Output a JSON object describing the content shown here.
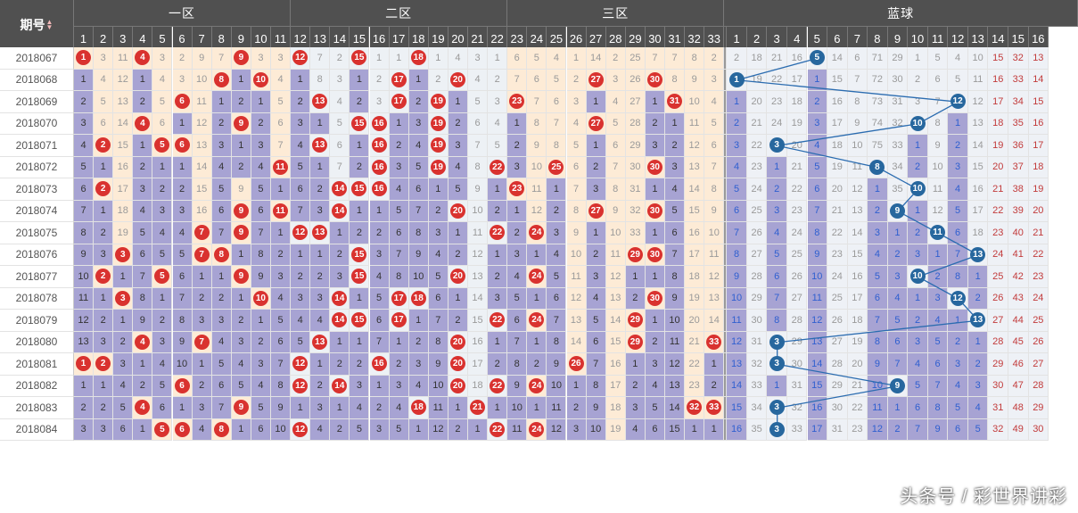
{
  "header": {
    "period": "期号",
    "zones": [
      "一区",
      "二区",
      "三区",
      "蓝球"
    ]
  },
  "red_cols": [
    "1",
    "2",
    "3",
    "4",
    "5",
    "6",
    "7",
    "8",
    "9",
    "10",
    "11",
    "12",
    "13",
    "14",
    "15",
    "16",
    "17",
    "18",
    "19",
    "20",
    "21",
    "22",
    "23",
    "24",
    "25",
    "26",
    "27",
    "28",
    "29",
    "30",
    "31",
    "32",
    "33"
  ],
  "blue_cols": [
    "1",
    "2",
    "3",
    "4",
    "5",
    "6",
    "7",
    "8",
    "9",
    "10",
    "11",
    "12",
    "13",
    "14",
    "15",
    "16"
  ],
  "rows": [
    {
      "p": "2018067",
      "hits": [
        1,
        4,
        9,
        12,
        15,
        18
      ],
      "blue": 5,
      "red_vals": [
        "1",
        "3",
        "11",
        "4",
        "3",
        "2",
        "9",
        "7",
        "9",
        "3",
        "3",
        "12",
        "7",
        "2",
        "15",
        "1",
        "1",
        "18",
        "1",
        "4",
        "3",
        "1",
        "6",
        "5",
        "4",
        "1",
        "14",
        "2",
        "25",
        "7",
        "7",
        "8",
        "2"
      ],
      "blue_vals": [
        "2",
        "18",
        "21",
        "16",
        "5",
        "14",
        "6",
        "71",
        "29",
        "1",
        "5",
        "4",
        "10",
        "15",
        "32",
        "13"
      ]
    },
    {
      "p": "2018068",
      "hits": [
        8,
        10,
        17,
        20,
        27,
        30
      ],
      "blue": 1,
      "red_vals": [
        "1",
        "4",
        "12",
        "1",
        "4",
        "3",
        "10",
        "8",
        "1",
        "10",
        "4",
        "1",
        "8",
        "3",
        "1",
        "2",
        "17",
        "1",
        "2",
        "20",
        "4",
        "2",
        "7",
        "6",
        "5",
        "2",
        "27",
        "3",
        "26",
        "30",
        "8",
        "9",
        "3"
      ],
      "blue_vals": [
        "1",
        "19",
        "22",
        "17",
        "1",
        "15",
        "7",
        "72",
        "30",
        "2",
        "6",
        "5",
        "11",
        "16",
        "33",
        "14"
      ]
    },
    {
      "p": "2018069",
      "hits": [
        6,
        13,
        17,
        19,
        23,
        31
      ],
      "blue": 12,
      "red_vals": [
        "2",
        "5",
        "13",
        "2",
        "5",
        "6",
        "11",
        "1",
        "2",
        "1",
        "5",
        "2",
        "13",
        "4",
        "2",
        "3",
        "17",
        "2",
        "19",
        "1",
        "5",
        "3",
        "23",
        "7",
        "6",
        "3",
        "1",
        "4",
        "27",
        "1",
        "31",
        "10",
        "4"
      ],
      "blue_vals": [
        "1",
        "20",
        "23",
        "18",
        "2",
        "16",
        "8",
        "73",
        "31",
        "3",
        "7",
        "12",
        "12",
        "17",
        "34",
        "15"
      ]
    },
    {
      "p": "2018070",
      "hits": [
        4,
        9,
        15,
        16,
        19,
        27
      ],
      "blue": 10,
      "red_vals": [
        "3",
        "6",
        "14",
        "4",
        "6",
        "1",
        "12",
        "2",
        "9",
        "2",
        "6",
        "3",
        "1",
        "5",
        "15",
        "16",
        "1",
        "3",
        "19",
        "2",
        "6",
        "4",
        "1",
        "8",
        "7",
        "4",
        "27",
        "5",
        "28",
        "2",
        "1",
        "11",
        "5"
      ],
      "blue_vals": [
        "2",
        "21",
        "24",
        "19",
        "3",
        "17",
        "9",
        "74",
        "32",
        "10",
        "8",
        "1",
        "13",
        "18",
        "35",
        "16"
      ]
    },
    {
      "p": "2018071",
      "hits": [
        2,
        5,
        6,
        13,
        16,
        19
      ],
      "blue": 3,
      "red_vals": [
        "4",
        "2",
        "15",
        "1",
        "5",
        "6",
        "13",
        "3",
        "1",
        "3",
        "7",
        "4",
        "13",
        "6",
        "1",
        "16",
        "2",
        "4",
        "19",
        "3",
        "7",
        "5",
        "2",
        "9",
        "8",
        "5",
        "1",
        "6",
        "29",
        "3",
        "2",
        "12",
        "6"
      ],
      "blue_vals": [
        "3",
        "22",
        "3",
        "20",
        "4",
        "18",
        "10",
        "75",
        "33",
        "1",
        "9",
        "2",
        "14",
        "19",
        "36",
        "17"
      ]
    },
    {
      "p": "2018072",
      "hits": [
        11,
        16,
        19,
        22,
        25,
        30
      ],
      "blue": 8,
      "red_vals": [
        "5",
        "1",
        "16",
        "2",
        "1",
        "1",
        "14",
        "4",
        "2",
        "4",
        "11",
        "5",
        "1",
        "7",
        "2",
        "16",
        "3",
        "5",
        "19",
        "4",
        "8",
        "22",
        "3",
        "10",
        "25",
        "6",
        "2",
        "7",
        "30",
        "30",
        "3",
        "13",
        "7"
      ],
      "blue_vals": [
        "4",
        "23",
        "1",
        "21",
        "5",
        "19",
        "11",
        "8",
        "34",
        "2",
        "10",
        "3",
        "15",
        "20",
        "37",
        "18"
      ]
    },
    {
      "p": "2018073",
      "hits": [
        2,
        14,
        15,
        16,
        23
      ],
      "blue": 10,
      "red_vals": [
        "6",
        "2",
        "17",
        "3",
        "2",
        "2",
        "15",
        "5",
        "9",
        "5",
        "1",
        "6",
        "2",
        "14",
        "15",
        "16",
        "4",
        "6",
        "1",
        "5",
        "9",
        "1",
        "23",
        "11",
        "1",
        "7",
        "3",
        "8",
        "31",
        "1",
        "4",
        "14",
        "8"
      ],
      "blue_vals": [
        "5",
        "24",
        "2",
        "22",
        "6",
        "20",
        "12",
        "1",
        "35",
        "10",
        "11",
        "4",
        "16",
        "21",
        "38",
        "19"
      ]
    },
    {
      "p": "2018074",
      "hits": [
        9,
        11,
        14,
        20,
        27,
        30
      ],
      "blue": 9,
      "red_vals": [
        "7",
        "1",
        "18",
        "4",
        "3",
        "3",
        "16",
        "6",
        "9",
        "6",
        "11",
        "7",
        "3",
        "14",
        "1",
        "1",
        "5",
        "7",
        "2",
        "20",
        "10",
        "2",
        "1",
        "12",
        "2",
        "8",
        "27",
        "9",
        "32",
        "30",
        "5",
        "15",
        "9"
      ],
      "blue_vals": [
        "6",
        "25",
        "3",
        "23",
        "7",
        "21",
        "13",
        "2",
        "9",
        "1",
        "12",
        "5",
        "17",
        "22",
        "39",
        "20"
      ]
    },
    {
      "p": "2018075",
      "hits": [
        7,
        9,
        12,
        13,
        22,
        24
      ],
      "blue": 11,
      "red_vals": [
        "8",
        "2",
        "19",
        "5",
        "4",
        "4",
        "7",
        "7",
        "9",
        "7",
        "1",
        "12",
        "13",
        "1",
        "2",
        "2",
        "6",
        "8",
        "3",
        "1",
        "11",
        "22",
        "2",
        "24",
        "3",
        "9",
        "1",
        "10",
        "33",
        "1",
        "6",
        "16",
        "10"
      ],
      "blue_vals": [
        "7",
        "26",
        "4",
        "24",
        "8",
        "22",
        "14",
        "3",
        "1",
        "2",
        "11",
        "6",
        "18",
        "23",
        "40",
        "21"
      ]
    },
    {
      "p": "2018076",
      "hits": [
        3,
        7,
        8,
        15,
        29,
        30
      ],
      "blue": 13,
      "red_vals": [
        "9",
        "3",
        "3",
        "6",
        "5",
        "5",
        "7",
        "8",
        "1",
        "8",
        "2",
        "1",
        "1",
        "2",
        "15",
        "3",
        "7",
        "9",
        "4",
        "2",
        "12",
        "1",
        "3",
        "1",
        "4",
        "10",
        "2",
        "11",
        "29",
        "30",
        "7",
        "17",
        "11"
      ],
      "blue_vals": [
        "8",
        "27",
        "5",
        "25",
        "9",
        "23",
        "15",
        "4",
        "2",
        "3",
        "1",
        "7",
        "13",
        "24",
        "41",
        "22"
      ]
    },
    {
      "p": "2018077",
      "hits": [
        2,
        5,
        9,
        15,
        20,
        24
      ],
      "blue": 10,
      "red_vals": [
        "10",
        "2",
        "1",
        "7",
        "5",
        "6",
        "1",
        "1",
        "9",
        "9",
        "3",
        "2",
        "2",
        "3",
        "15",
        "4",
        "8",
        "10",
        "5",
        "20",
        "13",
        "2",
        "4",
        "24",
        "5",
        "11",
        "3",
        "12",
        "1",
        "1",
        "8",
        "18",
        "12"
      ],
      "blue_vals": [
        "9",
        "28",
        "6",
        "26",
        "10",
        "24",
        "16",
        "5",
        "3",
        "10",
        "2",
        "8",
        "1",
        "25",
        "42",
        "23"
      ]
    },
    {
      "p": "2018078",
      "hits": [
        3,
        10,
        14,
        17,
        18,
        30
      ],
      "blue": 12,
      "red_vals": [
        "11",
        "1",
        "3",
        "8",
        "1",
        "7",
        "2",
        "2",
        "1",
        "10",
        "4",
        "3",
        "3",
        "14",
        "1",
        "5",
        "17",
        "18",
        "6",
        "1",
        "14",
        "3",
        "5",
        "1",
        "6",
        "12",
        "4",
        "13",
        "2",
        "30",
        "9",
        "19",
        "13"
      ],
      "blue_vals": [
        "10",
        "29",
        "7",
        "27",
        "11",
        "25",
        "17",
        "6",
        "4",
        "1",
        "3",
        "12",
        "2",
        "26",
        "43",
        "24"
      ]
    },
    {
      "p": "2018079",
      "hits": [
        14,
        15,
        17,
        22,
        24,
        29
      ],
      "blue": 13,
      "red_vals": [
        "12",
        "2",
        "1",
        "9",
        "2",
        "8",
        "3",
        "3",
        "2",
        "1",
        "5",
        "4",
        "4",
        "14",
        "15",
        "6",
        "17",
        "1",
        "7",
        "2",
        "15",
        "22",
        "6",
        "24",
        "7",
        "13",
        "5",
        "14",
        "29",
        "1",
        "10",
        "20",
        "14"
      ],
      "blue_vals": [
        "11",
        "30",
        "8",
        "28",
        "12",
        "26",
        "18",
        "7",
        "5",
        "2",
        "4",
        "1",
        "13",
        "27",
        "44",
        "25"
      ]
    },
    {
      "p": "2018080",
      "hits": [
        4,
        7,
        13,
        20,
        29,
        33
      ],
      "blue": 3,
      "red_vals": [
        "13",
        "3",
        "2",
        "4",
        "3",
        "9",
        "7",
        "4",
        "3",
        "2",
        "6",
        "5",
        "13",
        "1",
        "1",
        "7",
        "1",
        "2",
        "8",
        "20",
        "16",
        "1",
        "7",
        "1",
        "8",
        "14",
        "6",
        "15",
        "29",
        "2",
        "11",
        "21",
        "33"
      ],
      "blue_vals": [
        "12",
        "31",
        "3",
        "29",
        "13",
        "27",
        "19",
        "8",
        "6",
        "3",
        "5",
        "2",
        "1",
        "28",
        "45",
        "26"
      ]
    },
    {
      "p": "2018081",
      "hits": [
        1,
        2,
        12,
        16,
        20,
        26
      ],
      "blue": 3,
      "red_vals": [
        "1",
        "2",
        "3",
        "1",
        "4",
        "10",
        "1",
        "5",
        "4",
        "3",
        "7",
        "12",
        "1",
        "2",
        "2",
        "16",
        "2",
        "3",
        "9",
        "20",
        "17",
        "2",
        "8",
        "2",
        "9",
        "26",
        "7",
        "16",
        "1",
        "3",
        "12",
        "22",
        "1"
      ],
      "blue_vals": [
        "13",
        "32",
        "3",
        "30",
        "14",
        "28",
        "20",
        "9",
        "7",
        "4",
        "6",
        "3",
        "2",
        "29",
        "46",
        "27"
      ]
    },
    {
      "p": "2018082",
      "hits": [
        6,
        12,
        14,
        20,
        22,
        24
      ],
      "blue": 9,
      "red_vals": [
        "1",
        "1",
        "4",
        "2",
        "5",
        "6",
        "2",
        "6",
        "5",
        "4",
        "8",
        "12",
        "2",
        "14",
        "3",
        "1",
        "3",
        "4",
        "10",
        "20",
        "18",
        "22",
        "9",
        "24",
        "10",
        "1",
        "8",
        "17",
        "2",
        "4",
        "13",
        "23",
        "2"
      ],
      "blue_vals": [
        "14",
        "33",
        "1",
        "31",
        "15",
        "29",
        "21",
        "10",
        "9",
        "5",
        "7",
        "4",
        "3",
        "30",
        "47",
        "28"
      ]
    },
    {
      "p": "2018083",
      "hits": [
        4,
        9,
        18,
        21,
        32,
        33
      ],
      "blue": 3,
      "red_vals": [
        "2",
        "2",
        "5",
        "4",
        "6",
        "1",
        "3",
        "7",
        "9",
        "5",
        "9",
        "1",
        "3",
        "1",
        "4",
        "2",
        "4",
        "18",
        "11",
        "1",
        "21",
        "1",
        "10",
        "1",
        "11",
        "2",
        "9",
        "18",
        "3",
        "5",
        "14",
        "32",
        "33"
      ],
      "blue_vals": [
        "15",
        "34",
        "3",
        "32",
        "16",
        "30",
        "22",
        "11",
        "1",
        "6",
        "8",
        "5",
        "4",
        "31",
        "48",
        "29"
      ]
    },
    {
      "p": "2018084",
      "hits": [
        5,
        6,
        8,
        12,
        22,
        24
      ],
      "blue": 3,
      "red_vals": [
        "3",
        "3",
        "6",
        "1",
        "5",
        "6",
        "4",
        "8",
        "1",
        "6",
        "10",
        "12",
        "4",
        "2",
        "5",
        "3",
        "5",
        "1",
        "12",
        "2",
        "1",
        "22",
        "11",
        "24",
        "12",
        "3",
        "10",
        "19",
        "4",
        "6",
        "15",
        "1",
        "1"
      ],
      "blue_vals": [
        "16",
        "35",
        "3",
        "33",
        "17",
        "31",
        "23",
        "12",
        "2",
        "7",
        "9",
        "6",
        "5",
        "32",
        "49",
        "30"
      ]
    }
  ],
  "watermark": "头条号 / 彩世界讲彩"
}
